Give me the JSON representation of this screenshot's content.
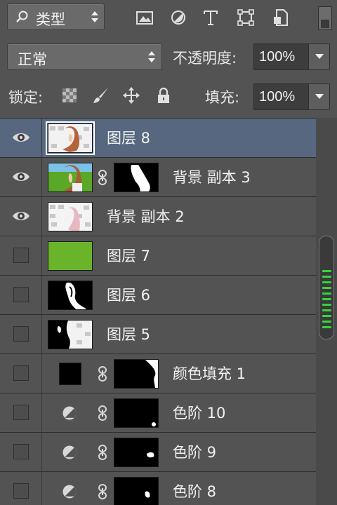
{
  "toolbar": {
    "filter_label": "类型",
    "icons": [
      "image-filter-icon",
      "adjustment-filter-icon",
      "type-filter-icon",
      "shape-filter-icon",
      "smart-object-filter-icon"
    ]
  },
  "blend": {
    "mode_label": "正常",
    "opacity_label": "不透明度:",
    "opacity_value": "100%"
  },
  "lock": {
    "lock_label": "锁定:",
    "fill_label": "填充:",
    "fill_value": "100%"
  },
  "layers": [
    {
      "name": "图层 8",
      "visible": true,
      "selected": true,
      "thumb": "photo-collage"
    },
    {
      "name": "背景 副本 3",
      "visible": true,
      "selected": false,
      "thumb": "photo-green",
      "mask": "mask-figure"
    },
    {
      "name": "背景 副本 2",
      "visible": true,
      "selected": false,
      "thumb": "photo-collage"
    },
    {
      "name": "图层 7",
      "visible": false,
      "selected": false,
      "thumb": "solid-green"
    },
    {
      "name": "图层 6",
      "visible": false,
      "selected": false,
      "thumb": "mask-black-figure"
    },
    {
      "name": "图层 5",
      "visible": false,
      "selected": false,
      "thumb": "collage-black"
    },
    {
      "name": "颜色填充 1",
      "visible": false,
      "selected": false,
      "thumb": "solid-black",
      "mask": "mask-edge"
    },
    {
      "name": "色阶 10",
      "visible": false,
      "selected": false,
      "adjustment": true,
      "mask": "mask-dot"
    },
    {
      "name": "色阶 9",
      "visible": false,
      "selected": false,
      "adjustment": true,
      "mask": "mask-blob"
    },
    {
      "name": "色阶 8",
      "visible": false,
      "selected": false,
      "adjustment": true,
      "mask": "mask-small"
    }
  ],
  "colors": {
    "panel_bg": "#535353",
    "selected_row": "#56677f",
    "scroll_grip": "#36d43c",
    "thumb_green": "#6ab42b"
  }
}
